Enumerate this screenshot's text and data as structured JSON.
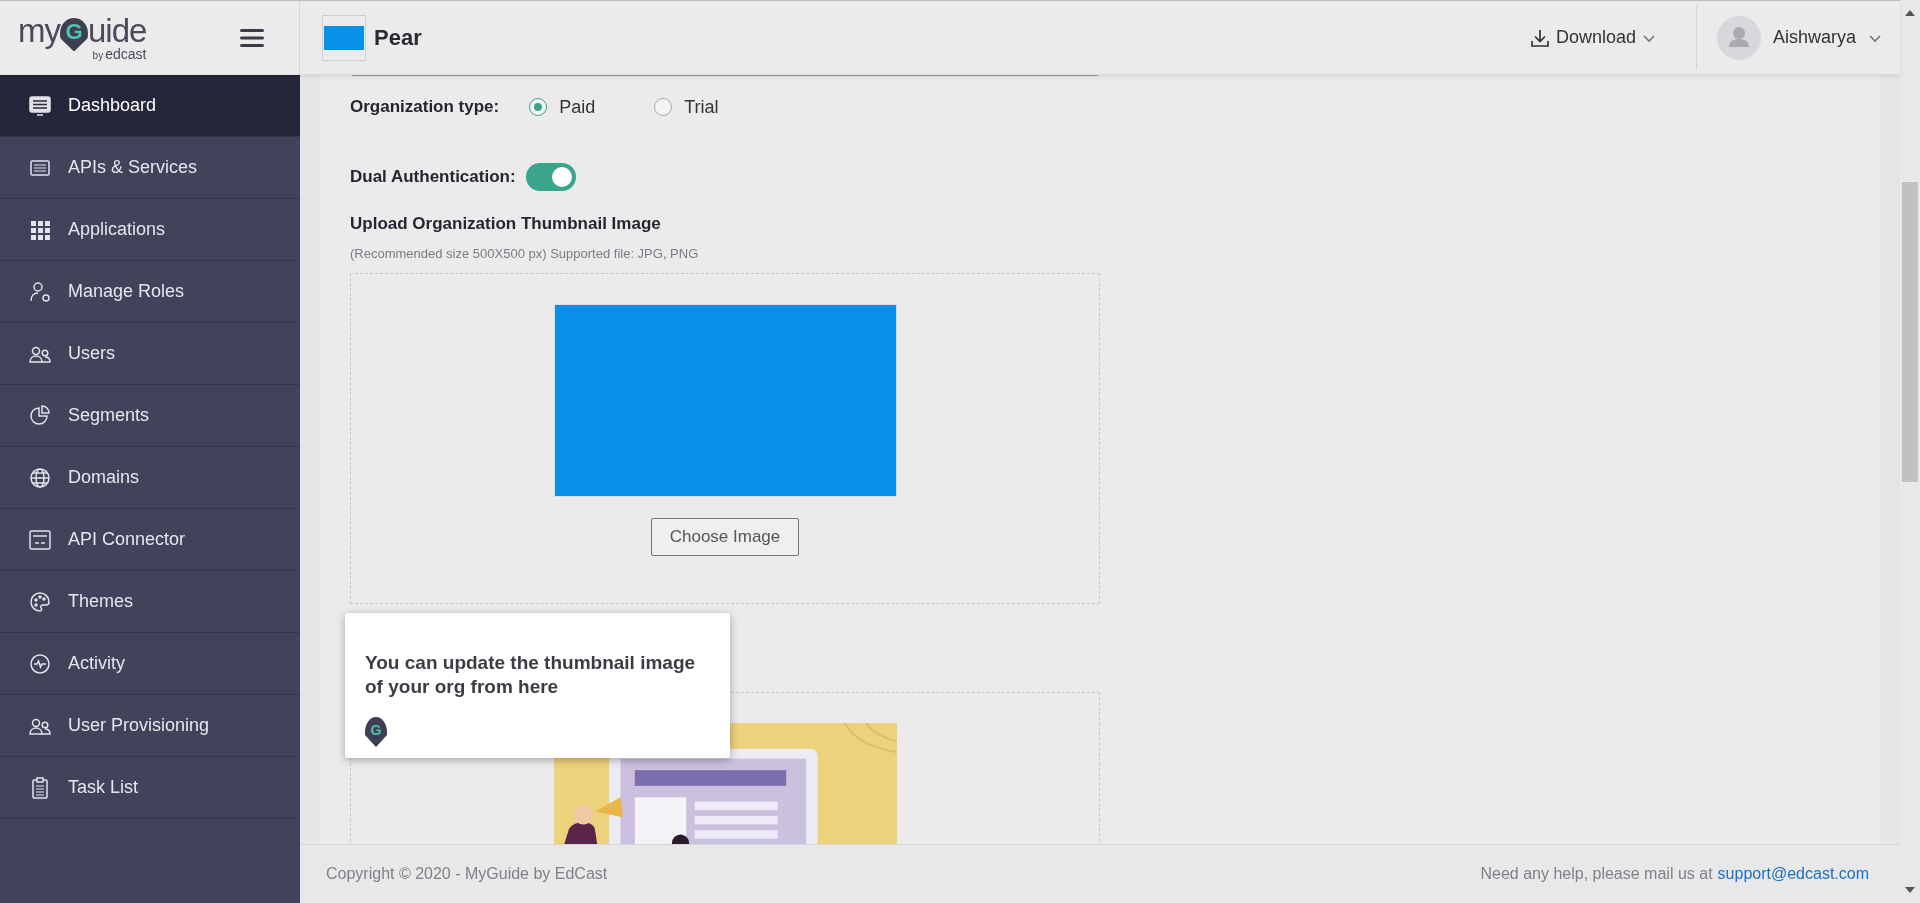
{
  "logo": {
    "before": "my",
    "pin_letter": "G",
    "after": "uide",
    "by": "by",
    "brand": "edcast"
  },
  "header": {
    "org_name": "Pear",
    "download": "Download",
    "user": "Aishwarya"
  },
  "sidebar": {
    "items": [
      {
        "label": "Dashboard",
        "kind": "dashboard",
        "selected": true
      },
      {
        "label": "APIs & Services",
        "kind": "api",
        "selected": false
      },
      {
        "label": "Applications",
        "kind": "grid",
        "selected": false
      },
      {
        "label": "Manage Roles",
        "kind": "roles",
        "selected": false
      },
      {
        "label": "Users",
        "kind": "users",
        "selected": false
      },
      {
        "label": "Segments",
        "kind": "pie",
        "selected": false
      },
      {
        "label": "Domains",
        "kind": "globe",
        "selected": false
      },
      {
        "label": "API Connector",
        "kind": "connector",
        "selected": false
      },
      {
        "label": "Themes",
        "kind": "palette",
        "selected": false
      },
      {
        "label": "Activity",
        "kind": "activity",
        "selected": false
      },
      {
        "label": "User Provisioning",
        "kind": "users",
        "selected": false
      },
      {
        "label": "Task List",
        "kind": "clipboard",
        "selected": false
      }
    ]
  },
  "form": {
    "org_type": {
      "label": "Organization type:",
      "options": [
        {
          "label": "Paid",
          "selected": true
        },
        {
          "label": "Trial",
          "selected": false
        }
      ]
    },
    "dual_auth": {
      "label": "Dual Authentication:",
      "on": true
    },
    "thumbnail": {
      "title": "Upload Organization Thumbnail Image",
      "hint": "(Recommended size 500X500 px) Supported file: JPG, PNG",
      "button": "Choose Image"
    }
  },
  "tooltip": {
    "text": "You can update the thumbnail image of your org from here",
    "pin_letter": "G"
  },
  "footer": {
    "copyright": "Copyright © 2020 - MyGuide by EdCast",
    "help": "Need any help, please mail us at",
    "email": "support@edcast.com"
  }
}
